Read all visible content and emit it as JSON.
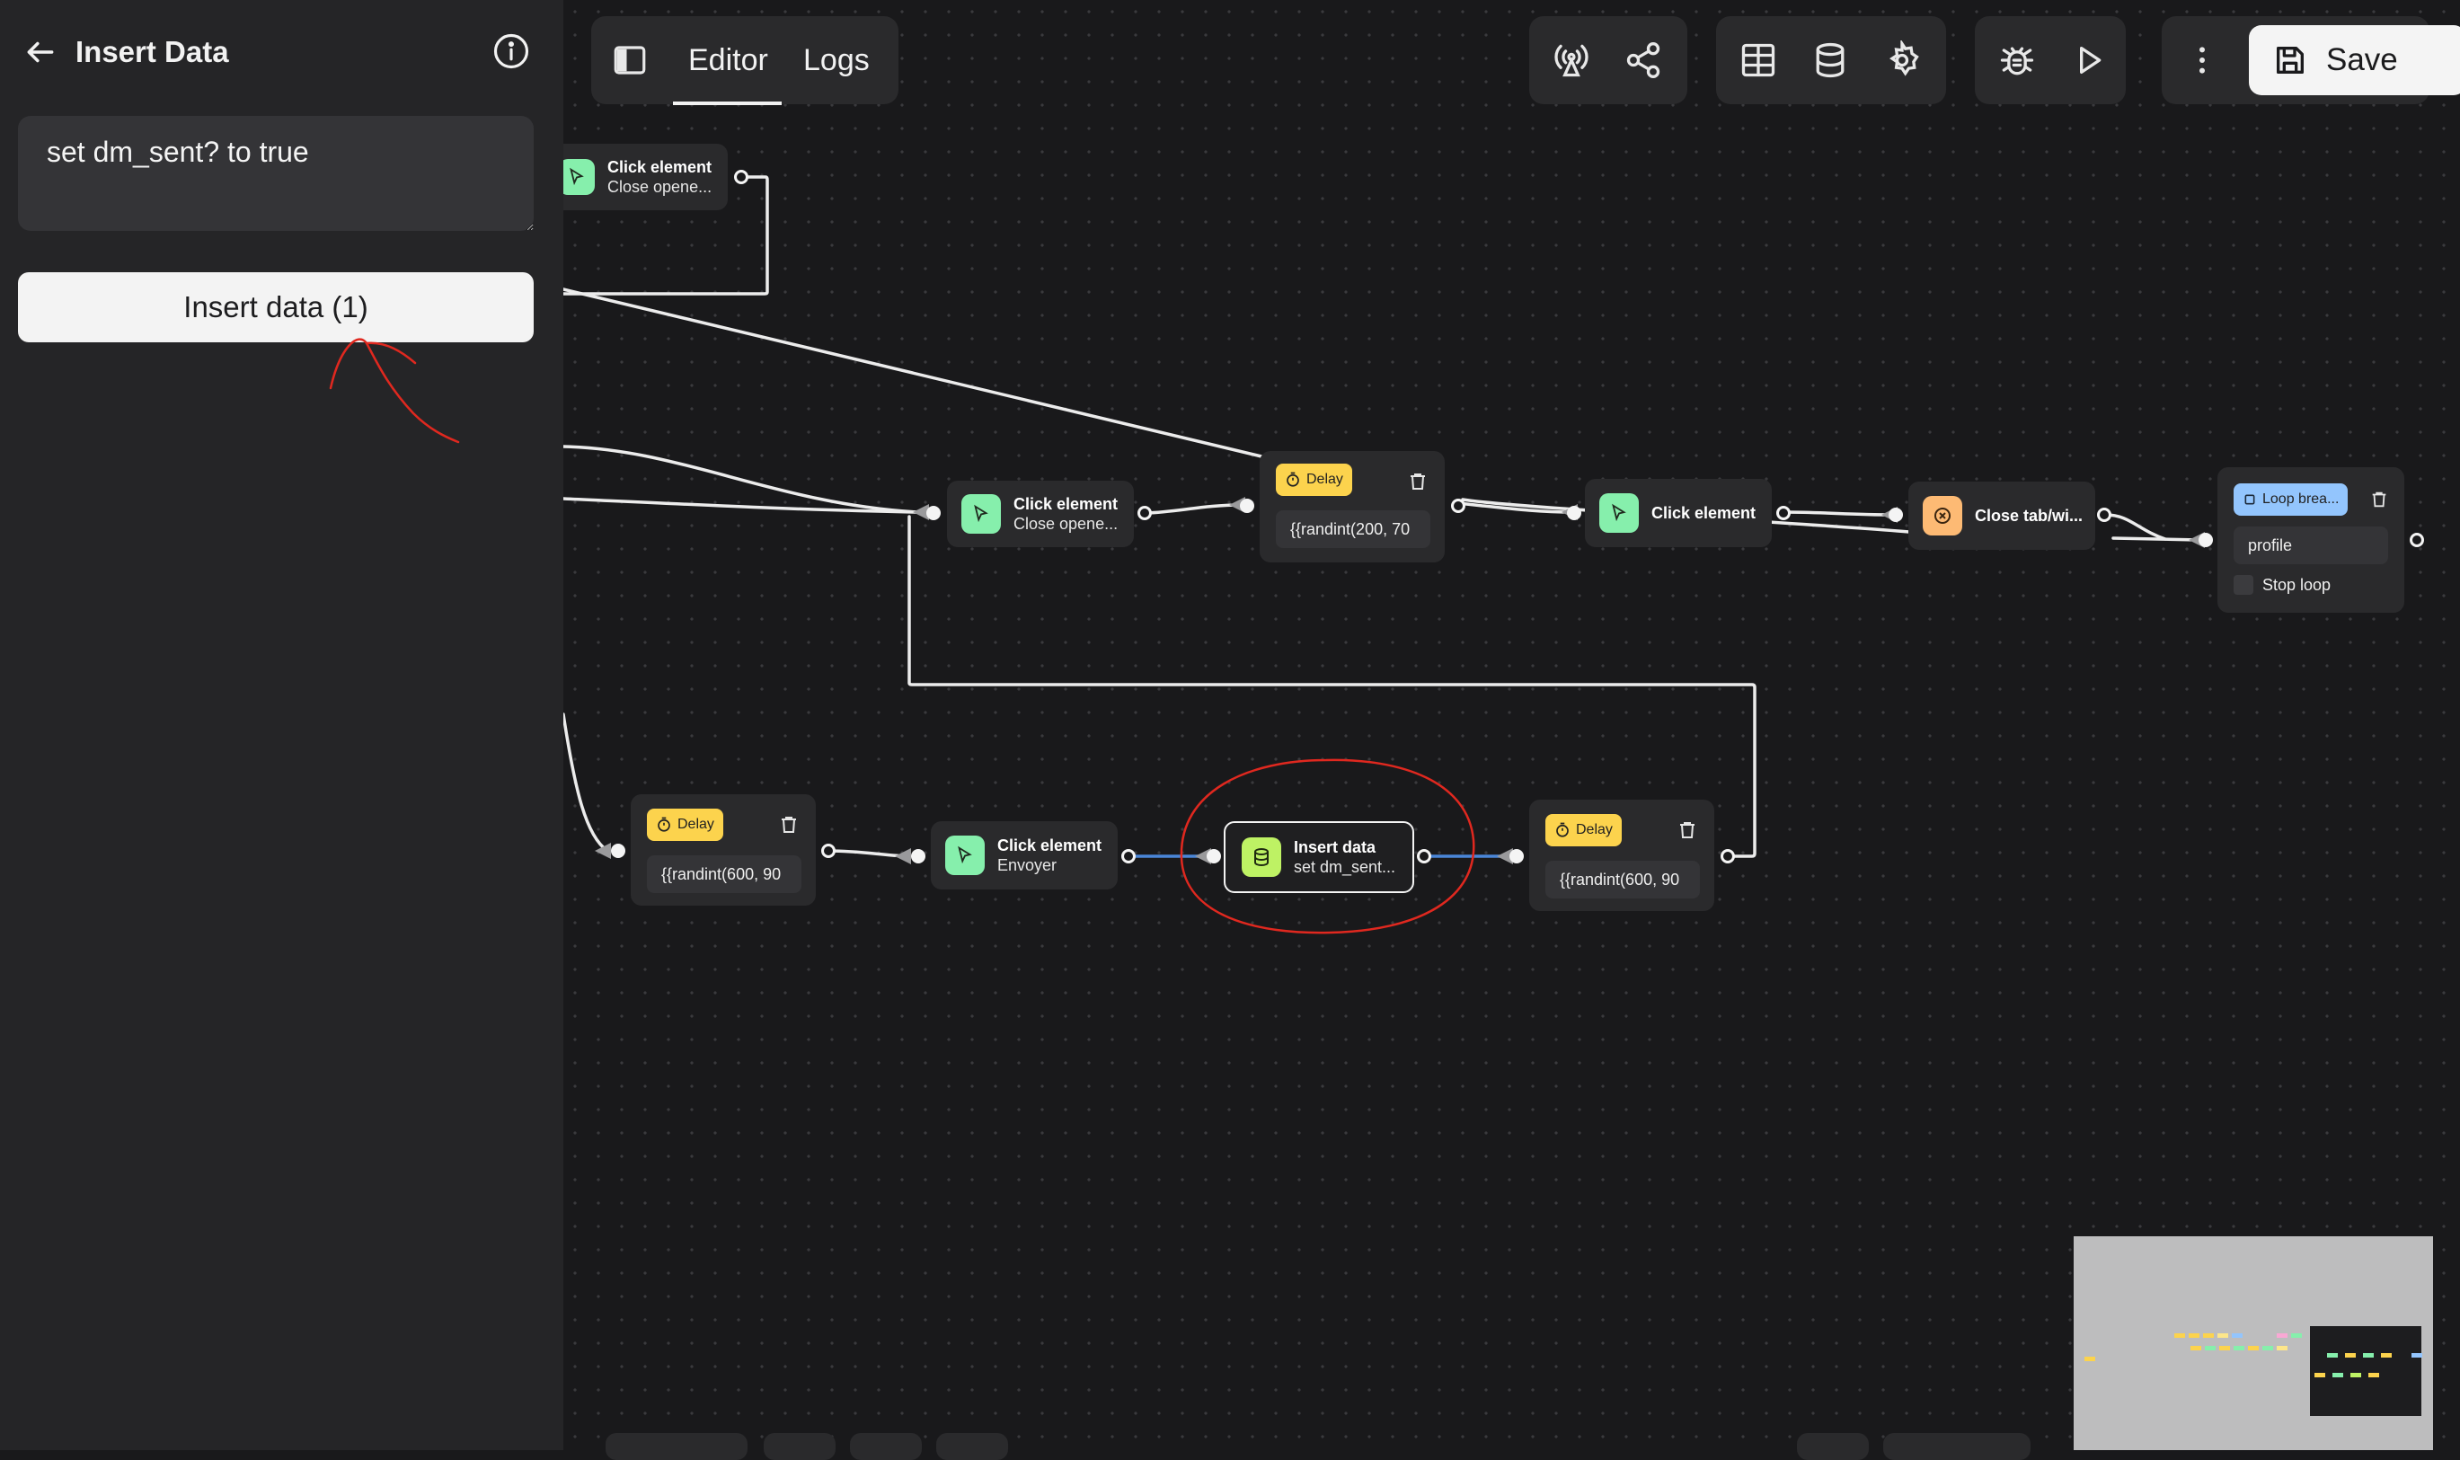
{
  "sidebar": {
    "title": "Insert Data",
    "textarea_value": "set dm_sent? to true",
    "button_label": "Insert data (1)"
  },
  "toolbar": {
    "tabs": [
      "Editor",
      "Logs"
    ],
    "active_tab": "Editor",
    "save_label": "Save",
    "icons": [
      "sidebar-toggle-icon",
      "broadcast-icon",
      "share-icon",
      "table-icon",
      "database-icon",
      "settings-icon",
      "bug-icon",
      "play-icon",
      "more-vertical-icon",
      "save-icon"
    ]
  },
  "nodes": {
    "top_click": {
      "title": "Click element",
      "subtitle": "Close opene..."
    },
    "click_mid": {
      "title": "Click element",
      "subtitle": "Close opene..."
    },
    "delay_mid": {
      "badge": "Delay",
      "value": "{{randint(200, 70"
    },
    "click_plain": {
      "title": "Click element"
    },
    "close_tab": {
      "title": "Close tab/wi..."
    },
    "loop_break": {
      "badge": "Loop brea...",
      "value": "profile",
      "checkbox_label": "Stop loop"
    },
    "delay_left": {
      "badge": "Delay",
      "value": "{{randint(600, 90"
    },
    "click_envoyer": {
      "title": "Click element",
      "subtitle": "Envoyer"
    },
    "insert_data": {
      "title": "Insert data",
      "subtitle": "set dm_sent..."
    },
    "delay_right": {
      "badge": "Delay",
      "value": "{{randint(600, 90"
    }
  },
  "colors": {
    "click_icon_bg": "#86efac",
    "delay_badge": "#fcd34d",
    "insert_icon_bg": "#bef264",
    "close_icon_bg": "#fdba74",
    "loop_badge": "#93c5fd",
    "annotation": "#e0281f",
    "active_edge": "#4a86d8"
  }
}
